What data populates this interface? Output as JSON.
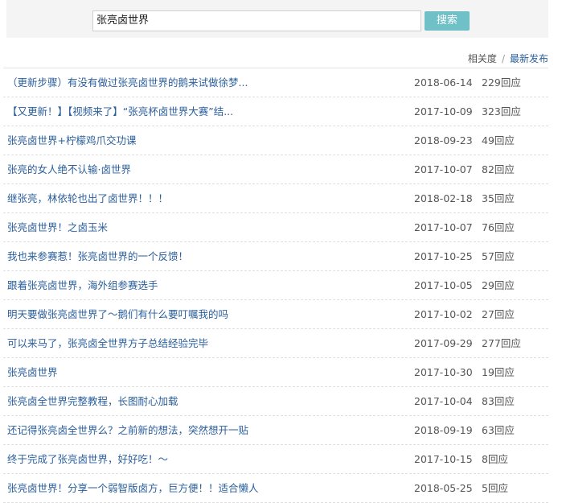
{
  "search": {
    "value": "张亮卤世界",
    "button_label": "搜索"
  },
  "sort": {
    "relevance_label": "相关度",
    "separator": "/",
    "latest_label": "最新发布"
  },
  "results": [
    {
      "title": "（更新步骤）有没有做过张亮卤世界的鹅来试做徐梦...",
      "date": "2018-06-14",
      "replies": "229回应"
    },
    {
      "title": "【又更新！】【视频来了】“张亮杯卤世界大赛”结...",
      "date": "2017-10-09",
      "replies": "323回应"
    },
    {
      "title": "张亮卤世界+柠檬鸡爪交功课",
      "date": "2018-09-23",
      "replies": "49回应"
    },
    {
      "title": "张亮的女人绝不认输·卤世界",
      "date": "2017-10-07",
      "replies": "82回应"
    },
    {
      "title": "继张亮，林依轮也出了卤世界！！！",
      "date": "2018-02-18",
      "replies": "35回应"
    },
    {
      "title": "张亮卤世界！之卤玉米",
      "date": "2017-10-07",
      "replies": "76回应"
    },
    {
      "title": "我也来参赛惹！张亮卤世界的一个反馈！",
      "date": "2017-10-25",
      "replies": "57回应"
    },
    {
      "title": "跟着张亮卤世界，海外组参赛选手",
      "date": "2017-10-05",
      "replies": "29回应"
    },
    {
      "title": "明天要做张亮卤世界了～鹅们有什么要叮嘱我的吗",
      "date": "2017-10-02",
      "replies": "27回应"
    },
    {
      "title": "可以来马了，张亮卤全世界方子总结经验完毕",
      "date": "2017-09-29",
      "replies": "277回应"
    },
    {
      "title": "张亮卤世界",
      "date": "2017-10-30",
      "replies": "19回应"
    },
    {
      "title": "张亮卤全世界完整教程，长图耐心加载",
      "date": "2017-10-04",
      "replies": "83回应"
    },
    {
      "title": "还记得张亮卤全世界么？之前新的想法，突然想开一贴",
      "date": "2018-09-19",
      "replies": "63回应"
    },
    {
      "title": "终于完成了张亮卤世界，好好吃！～",
      "date": "2017-10-15",
      "replies": "8回应"
    },
    {
      "title": "张亮卤世界！分享一个弱智版卤方，巨方便！！适合懒人",
      "date": "2018-05-25",
      "replies": "5回应"
    }
  ]
}
